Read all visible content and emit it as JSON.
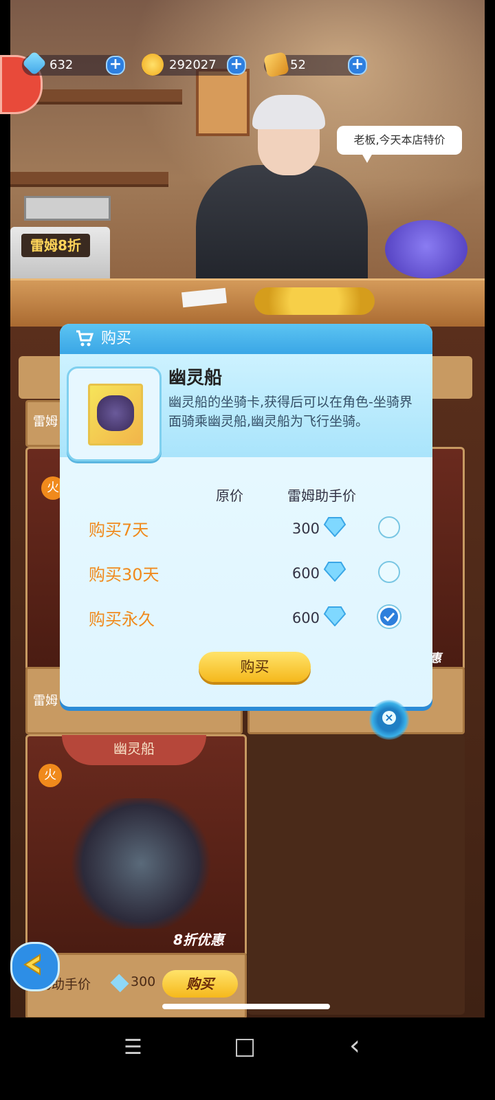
{
  "top_bar": {
    "gems": "632",
    "coins": "292027",
    "tickets": "52",
    "plus_icon": "plus-icon"
  },
  "shop": {
    "speech": "老板,今天本店特价",
    "register_sign": "雷姆8折",
    "card_label_left": "雷姆",
    "card_label_left2": "雷姆",
    "hot_tag": "火",
    "discount_tag": "8折优惠",
    "discount_tag_right": "惠",
    "item_card_title": "幽灵船",
    "item_card_price_label": "姆助手价",
    "item_card_price": "300",
    "item_card_buy": "购买"
  },
  "dialog": {
    "title": "购买",
    "item_name": "幽灵船",
    "item_desc": "幽灵船的坐骑卡,获得后可以在角色-坐骑界面骑乘幽灵船,幽灵船为飞行坐骑。",
    "col_original": "原价",
    "col_helper": "雷姆助手价",
    "options": [
      {
        "label": "购买7天",
        "price": "300",
        "selected": false
      },
      {
        "label": "购买30天",
        "price": "600",
        "selected": false
      },
      {
        "label": "购买永久",
        "price": "600",
        "selected": true
      }
    ],
    "buy_label": "购买",
    "close_glyph": "×"
  },
  "nav": {
    "menu_glyph": "☰",
    "home_glyph": "□",
    "back_glyph": "‹"
  },
  "colors": {
    "dialog_header": "#3aa6e6",
    "option_label": "#f08a1c",
    "buy_button": "#f5b81c"
  }
}
